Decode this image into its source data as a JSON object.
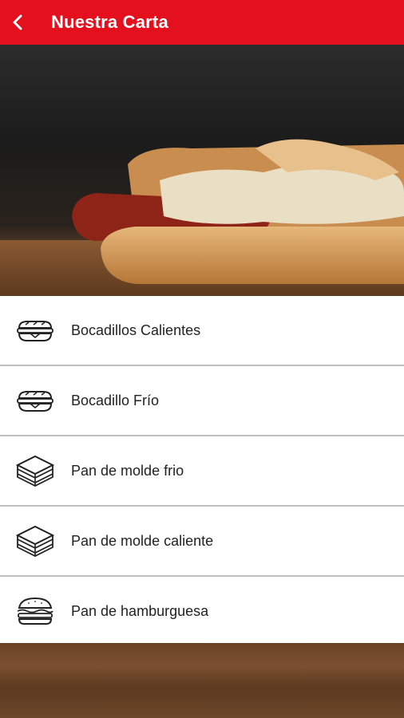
{
  "header": {
    "title": "Nuestra Carta",
    "back_icon": "chevron-left-icon"
  },
  "colors": {
    "accent": "#e4101d",
    "item_bg": "#ffffff",
    "divider": "#bdbdbd"
  },
  "menu": {
    "items": [
      {
        "label": "Bocadillos Calientes",
        "icon": "baguette-icon"
      },
      {
        "label": "Bocadillo Frío",
        "icon": "baguette-icon"
      },
      {
        "label": "Pan de molde frio",
        "icon": "sandwich-icon"
      },
      {
        "label": "Pan de molde caliente",
        "icon": "sandwich-icon"
      },
      {
        "label": "Pan de hamburguesa",
        "icon": "burger-icon"
      }
    ]
  }
}
